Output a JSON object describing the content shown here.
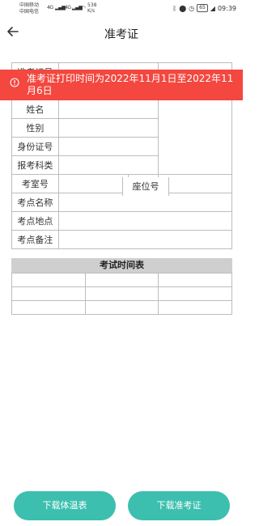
{
  "status_bar": {
    "carrier_1": "中国移动",
    "carrier_2": "中国电信",
    "net_1": "4G",
    "net_2": "4G",
    "speed_value": "538",
    "speed_unit": "K/s",
    "battery": "65",
    "time": "09:39"
  },
  "header": {
    "title": "准考证"
  },
  "banner": {
    "text": "准考证打印时间为2022年11月1日至2022年11月6日",
    "color": "#f3473f"
  },
  "form": {
    "row1_label": "准考证号",
    "name_label": "姓名",
    "gender_label": "性别",
    "id_label": "身份证号",
    "subject_label": "报考科类",
    "room_label": "考室号",
    "seat_label": "座位号",
    "site_name_label": "考点名称",
    "site_address_label": "考点地点",
    "site_note_label": "考点备注"
  },
  "schedule": {
    "title": "考试时间表"
  },
  "buttons": {
    "download_temperature": "下载体温表",
    "download_admission": "下载准考证",
    "color": "#3dbfaf"
  }
}
